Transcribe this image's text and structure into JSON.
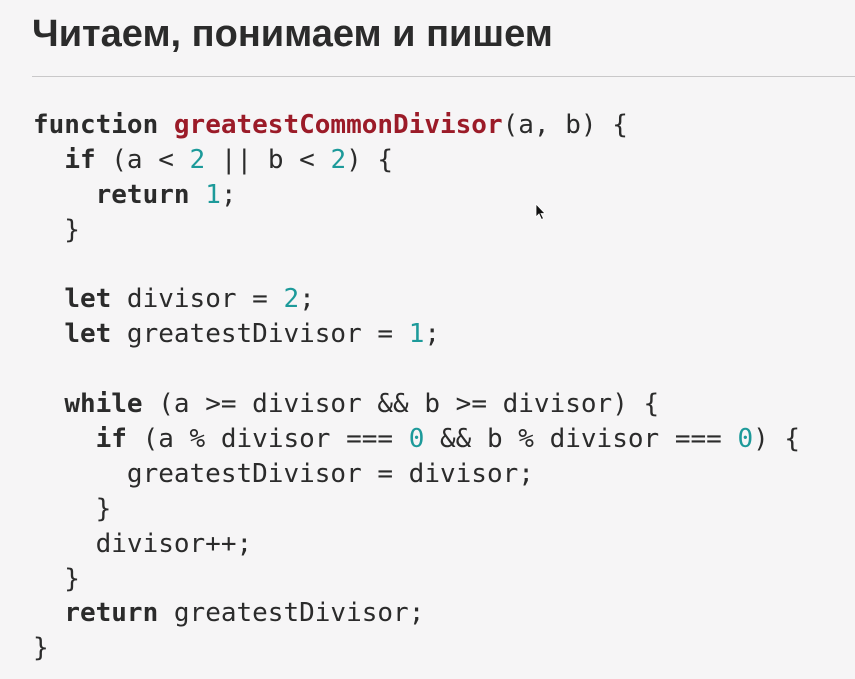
{
  "slide": {
    "title": "Читаем, понимаем и пишем"
  },
  "code": {
    "lines": [
      [
        {
          "t": "kw",
          "v": "function"
        },
        {
          "t": "p",
          "v": " "
        },
        {
          "t": "fn",
          "v": "greatestCommonDivisor"
        },
        {
          "t": "p",
          "v": "(a, b) {"
        }
      ],
      [
        {
          "t": "p",
          "v": "  "
        },
        {
          "t": "kw",
          "v": "if"
        },
        {
          "t": "p",
          "v": " (a < "
        },
        {
          "t": "num",
          "v": "2"
        },
        {
          "t": "p",
          "v": " || b < "
        },
        {
          "t": "num",
          "v": "2"
        },
        {
          "t": "p",
          "v": ") {"
        }
      ],
      [
        {
          "t": "p",
          "v": "    "
        },
        {
          "t": "kw",
          "v": "return"
        },
        {
          "t": "p",
          "v": " "
        },
        {
          "t": "num",
          "v": "1"
        },
        {
          "t": "p",
          "v": ";"
        }
      ],
      [
        {
          "t": "p",
          "v": "  }"
        }
      ],
      [
        {
          "t": "p",
          "v": ""
        }
      ],
      [
        {
          "t": "p",
          "v": "  "
        },
        {
          "t": "kw",
          "v": "let"
        },
        {
          "t": "p",
          "v": " divisor = "
        },
        {
          "t": "num",
          "v": "2"
        },
        {
          "t": "p",
          "v": ";"
        }
      ],
      [
        {
          "t": "p",
          "v": "  "
        },
        {
          "t": "kw",
          "v": "let"
        },
        {
          "t": "p",
          "v": " greatestDivisor = "
        },
        {
          "t": "num",
          "v": "1"
        },
        {
          "t": "p",
          "v": ";"
        }
      ],
      [
        {
          "t": "p",
          "v": ""
        }
      ],
      [
        {
          "t": "p",
          "v": "  "
        },
        {
          "t": "kw",
          "v": "while"
        },
        {
          "t": "p",
          "v": " (a >= divisor && b >= divisor) {"
        }
      ],
      [
        {
          "t": "p",
          "v": "    "
        },
        {
          "t": "kw",
          "v": "if"
        },
        {
          "t": "p",
          "v": " (a % divisor === "
        },
        {
          "t": "num",
          "v": "0"
        },
        {
          "t": "p",
          "v": " && b % divisor === "
        },
        {
          "t": "num",
          "v": "0"
        },
        {
          "t": "p",
          "v": ") {"
        }
      ],
      [
        {
          "t": "p",
          "v": "      greatestDivisor = divisor;"
        }
      ],
      [
        {
          "t": "p",
          "v": "    }"
        }
      ],
      [
        {
          "t": "p",
          "v": "    divisor++;"
        }
      ],
      [
        {
          "t": "p",
          "v": "  }"
        }
      ],
      [
        {
          "t": "p",
          "v": "  "
        },
        {
          "t": "kw",
          "v": "return"
        },
        {
          "t": "p",
          "v": " greatestDivisor;"
        }
      ],
      [
        {
          "t": "p",
          "v": "}"
        }
      ]
    ]
  },
  "icons": {
    "cursor": "mouse-pointer-icon"
  },
  "colors": {
    "background": "#f6f5f6",
    "text": "#2b2b2b",
    "function_name": "#9b1b28",
    "number_literal": "#1d9a9a",
    "divider": "#c9c8c9"
  }
}
